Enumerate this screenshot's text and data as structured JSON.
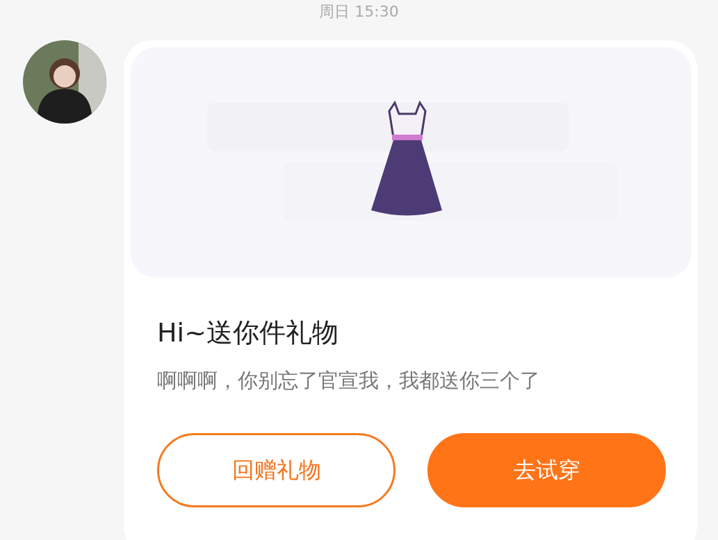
{
  "timestamp": "周日 15:30",
  "message": {
    "title": "Hi~送你件礼物",
    "text": "啊啊啊，你别忘了官宣我，我都送你三个了",
    "buttons": [
      {
        "label": "回赠礼物",
        "kind": "outline"
      },
      {
        "label": "去试穿",
        "kind": "filled"
      }
    ]
  }
}
